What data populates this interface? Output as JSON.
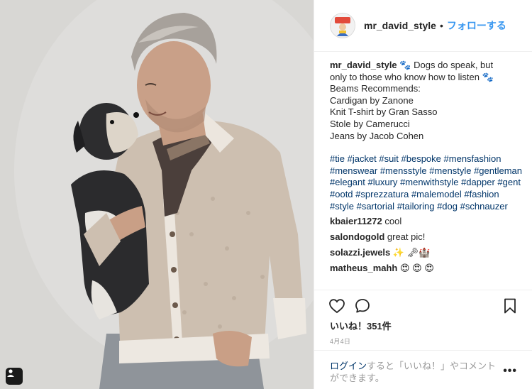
{
  "post": {
    "username": "mr_david_style",
    "follow_label": "フォローする",
    "separator": "•",
    "caption": {
      "user": "mr_david_style",
      "paw_emoji": "🐾",
      "line1": "Dogs do speak, but",
      "line2": "only to those who know how to listen",
      "line3": "Beams Recommends:",
      "line4": "Cardigan by Zanone",
      "line5": "Knit T-shirt by Gran Sasso",
      "line6": "Stole by Camerucci",
      "line7": "Jeans by Jacob Cohen"
    },
    "hashtags": [
      "#tie",
      "#jacket",
      "#suit",
      "#bespoke",
      "#mensfashion",
      "#menswear",
      "#mensstyle",
      "#menstyle",
      "#gentleman",
      "#elegant",
      "#luxury",
      "#menwithstyle",
      "#dapper",
      "#gent",
      "#ootd",
      "#sprezzatura",
      "#malemodel",
      "#fashion",
      "#style",
      "#sartorial",
      "#tailoring",
      "#dog",
      "#schnauzer"
    ],
    "comments": [
      {
        "user": "kbaier11272",
        "text": "cool"
      },
      {
        "user": "salondogold",
        "text": "great pic!"
      },
      {
        "user": "solazzi.jewels",
        "text": "✨ 🗝🏰"
      },
      {
        "user": "matheus_mahh",
        "text": "😍 😍 😍"
      }
    ],
    "likes_label": "いいね！351件",
    "date_label": "4月4日",
    "login_prompt": {
      "link": "ログイン",
      "text": "すると「いいね！」やコメント",
      "text2": "ができます。"
    },
    "more_label": "•••"
  },
  "icons": {
    "like": "heart-outline-icon",
    "comment": "speech-bubble-icon",
    "save": "bookmark-icon",
    "user_tag": "user-tag-icon"
  },
  "colors": {
    "link_blue": "#3897f0",
    "hashtag_navy": "#003569",
    "text": "#262626",
    "muted": "#999999"
  }
}
